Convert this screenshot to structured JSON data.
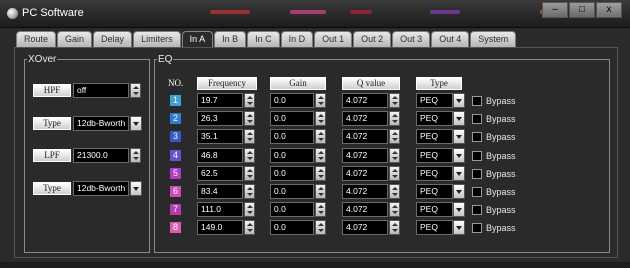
{
  "window": {
    "title": "PC Software",
    "minimize_label": "–",
    "maximize_label": "□",
    "close_label": "x"
  },
  "tabs": [
    "Route",
    "Gain",
    "Delay",
    "Limiters",
    "In A",
    "In B",
    "In C",
    "In D",
    "Out 1",
    "Out 2",
    "Out 3",
    "Out 4",
    "System"
  ],
  "active_tab": "In A",
  "xover": {
    "legend": "XOver",
    "hpf_label": "HPF",
    "hpf_value": "off",
    "hpf_type_label": "Type",
    "hpf_type_value": "12db-Bworth",
    "lpf_label": "LPF",
    "lpf_value": "21300.0",
    "lpf_type_label": "Type",
    "lpf_type_value": "12db-Bworth"
  },
  "eq": {
    "legend": "EQ",
    "headers": {
      "no": "NO.",
      "frequency": "Frequency",
      "gain": "Gain",
      "q": "Q value",
      "type": "Type"
    },
    "bypass_label": "Bypass",
    "bands": [
      {
        "no": "1",
        "color": "#3aa0d8",
        "freq": "19.7",
        "gain": "0.0",
        "q": "4.072",
        "type": "PEQ"
      },
      {
        "no": "2",
        "color": "#2b7fd4",
        "freq": "26.3",
        "gain": "0.0",
        "q": "4.072",
        "type": "PEQ"
      },
      {
        "no": "3",
        "color": "#3558c8",
        "freq": "35.1",
        "gain": "0.0",
        "q": "4.072",
        "type": "PEQ"
      },
      {
        "no": "4",
        "color": "#6a4fd0",
        "freq": "46.8",
        "gain": "0.0",
        "q": "4.072",
        "type": "PEQ"
      },
      {
        "no": "5",
        "color": "#b03ad0",
        "freq": "62.5",
        "gain": "0.0",
        "q": "4.072",
        "type": "PEQ"
      },
      {
        "no": "6",
        "color": "#d04ab8",
        "freq": "83.4",
        "gain": "0.0",
        "q": "4.072",
        "type": "PEQ"
      },
      {
        "no": "7",
        "color": "#b83ab0",
        "freq": "111.0",
        "gain": "0.0",
        "q": "4.072",
        "type": "PEQ"
      },
      {
        "no": "8",
        "color": "#e25ab0",
        "freq": "149.0",
        "gain": "0.0",
        "q": "4.072",
        "type": "PEQ"
      }
    ]
  }
}
